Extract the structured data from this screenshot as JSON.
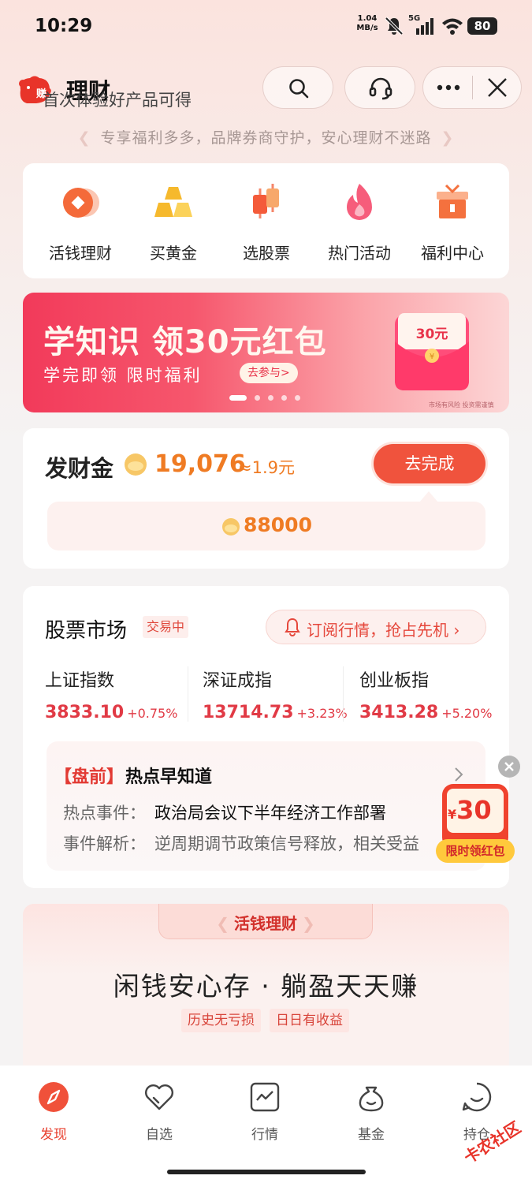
{
  "status_bar": {
    "time": "10:29",
    "net_speed_value": "1.04",
    "net_speed_unit": "MB/s",
    "network": "5G",
    "battery": "80"
  },
  "header": {
    "title": "理财",
    "logo_text": "赚",
    "slogan": "专享福利多多，品牌券商守护，安心理财不迷路"
  },
  "quick_entries": [
    {
      "label": "活钱理财",
      "icon": "coin-icon"
    },
    {
      "label": "买黄金",
      "icon": "gold-bars-icon"
    },
    {
      "label": "选股票",
      "icon": "candlestick-icon"
    },
    {
      "label": "热门活动",
      "icon": "flame-icon"
    },
    {
      "label": "福利中心",
      "icon": "gift-icon"
    }
  ],
  "banner": {
    "title": "学知识 领30元红包",
    "subtitle": "学完即领  限时福利",
    "cta": "去参与>",
    "packet_amount": "30元",
    "note": "市场有风险 投资需谨慎",
    "slide_count": 5,
    "active_slide": 1
  },
  "gold": {
    "title": "发财金",
    "amount": "19,076",
    "approx": "≈1.9元",
    "button": "去完成",
    "tip_text": "首次体验好产品可得",
    "tip_amount": "88000"
  },
  "market": {
    "title": "股票市场",
    "badge": "交易中",
    "subscribe": "订阅行情，抢占先机 ›",
    "indices": [
      {
        "name": "上证指数",
        "value": "3833.10",
        "change": "+0.75%"
      },
      {
        "name": "深证成指",
        "value": "13714.73",
        "change": "+3.23%"
      },
      {
        "name": "创业板指",
        "value": "3413.28",
        "change": "+5.20%"
      }
    ],
    "news": {
      "tag": "【盘前】",
      "title": "热点早知道",
      "line1_label": "热点事件：",
      "line1": "政治局会议下半年经济工作部署",
      "line2_label": "事件解析：",
      "line2": "逆周期调节政策信号释放，相关受益"
    }
  },
  "float_packet": {
    "currency": "¥",
    "amount": "30",
    "label": "限时领红包"
  },
  "savings": {
    "tab": "活钱理财",
    "headline": "闲钱安心存 · 躺盈天天赚",
    "tags": [
      "历史无亏损",
      "日日有收益"
    ]
  },
  "nav": [
    {
      "label": "发现",
      "icon": "compass-icon",
      "active": true
    },
    {
      "label": "自选",
      "icon": "heart-icon",
      "active": false
    },
    {
      "label": "行情",
      "icon": "chart-icon",
      "active": false
    },
    {
      "label": "基金",
      "icon": "money-bag-icon",
      "active": false
    },
    {
      "label": "持仓",
      "icon": "smile-icon",
      "active": false
    }
  ],
  "watermark": "卡农社区",
  "colors": {
    "accent": "#e8402f",
    "gold": "#ef7b23",
    "up": "#e13a45"
  }
}
